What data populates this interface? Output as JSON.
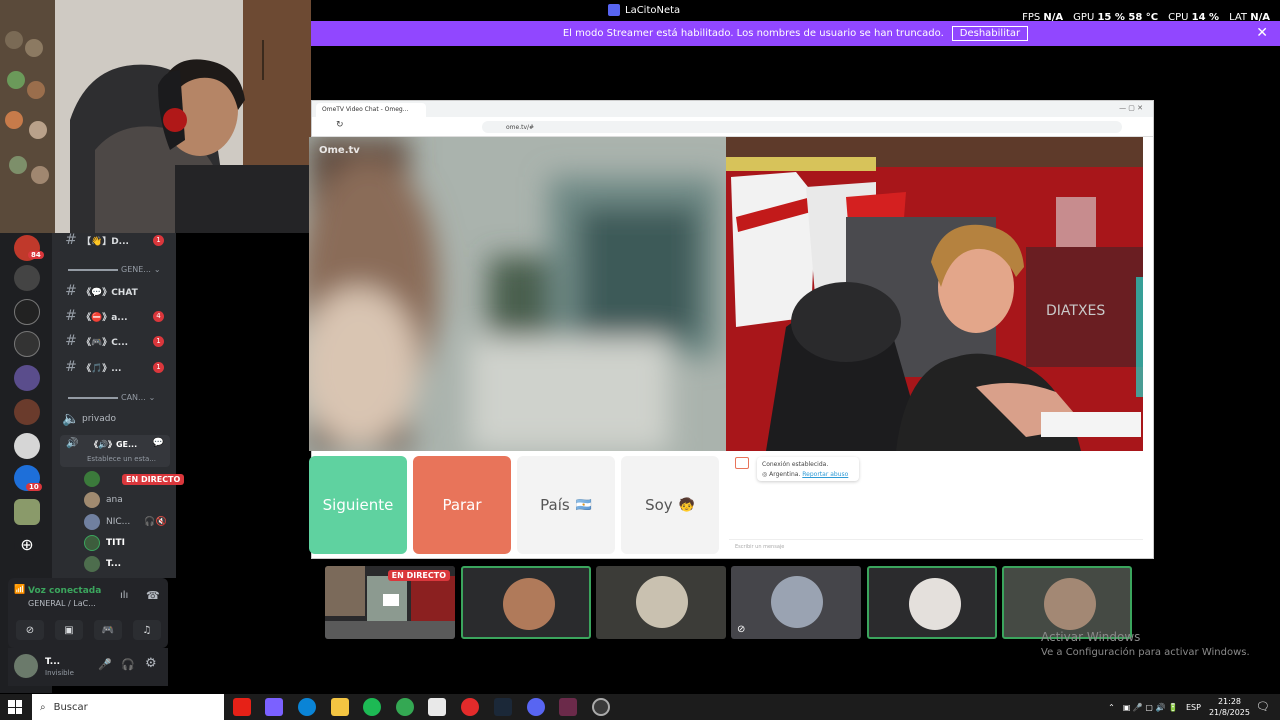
{
  "titlebar": {
    "app_title": "LaCitoNeta",
    "hud": [
      {
        "label": "FPS",
        "value": "N/A"
      },
      {
        "label": "GPU",
        "value": "15 % 58 °C"
      },
      {
        "label": "CPU",
        "value": "14 %"
      },
      {
        "label": "LAT",
        "value": "N/A"
      }
    ]
  },
  "streamer_banner": {
    "text": "El modo Streamer está habilitado. Los nombres de usuario se han truncado.",
    "button": "Deshabilitar"
  },
  "servers": [
    {
      "icon": "server-icon",
      "badge": "84"
    },
    {
      "icon": "server-icon"
    },
    {
      "icon": "server-icon"
    },
    {
      "icon": "server-icon"
    },
    {
      "icon": "server-icon"
    },
    {
      "icon": "server-icon"
    },
    {
      "icon": "server-icon"
    },
    {
      "icon": "server-icon",
      "badge": "10"
    },
    {
      "icon": "server-icon"
    }
  ],
  "channels": [
    {
      "name": "【👋】D...",
      "badge": "1"
    },
    {
      "name": "《💬》CHAT"
    },
    {
      "name": "《⛔》a...",
      "badge": "4"
    },
    {
      "name": "《🎮》C...",
      "badge": "1"
    },
    {
      "name": "《🎵》...",
      "badge": "1"
    }
  ],
  "categories": [
    "GENE...",
    "CAN..."
  ],
  "voice_channels": {
    "private": "privado",
    "active_name": "《🔊》GE...",
    "active_status": "Establece un esta..."
  },
  "members": [
    {
      "name": "",
      "live": "EN DIRECTO"
    },
    {
      "name": "ana"
    },
    {
      "name": "NIC..."
    },
    {
      "name": "TITI"
    },
    {
      "name": "T..."
    }
  ],
  "voice_panel": {
    "title": "Voz conectada",
    "subtitle": "GENERAL / LaC..."
  },
  "user_panel": {
    "name": "T...",
    "status": "Invisible"
  },
  "browser": {
    "tab_title": "OmeTV Video Chat - Omeg...",
    "url": "ome.tv/#",
    "logo": "Ome.tv"
  },
  "ome_buttons": {
    "next": "Siguiente",
    "stop": "Parar",
    "country": "País",
    "country_flag": "🇦🇷",
    "me": "Soy",
    "me_emoji": "🧒"
  },
  "chat": {
    "connected": "Conexión establecida.",
    "country": "Argentina.",
    "report": "Reportar abuso",
    "placeholder": "Escribir un mensaje"
  },
  "stream_tile": {
    "live": "EN DIRECTO"
  },
  "watermark": {
    "title": "Activar Windows",
    "subtitle": "Ve a Configuración para activar Windows."
  },
  "taskbar": {
    "search": "Buscar",
    "lang": "ESP",
    "time": "21:28",
    "date": "21/8/2025"
  },
  "colors": {
    "streamer_purple": "#9147ff",
    "next_green": "#5fd2a0",
    "stop_red": "#e8745a",
    "discord_red": "#da373c",
    "speaking_green": "#3ba55d"
  }
}
